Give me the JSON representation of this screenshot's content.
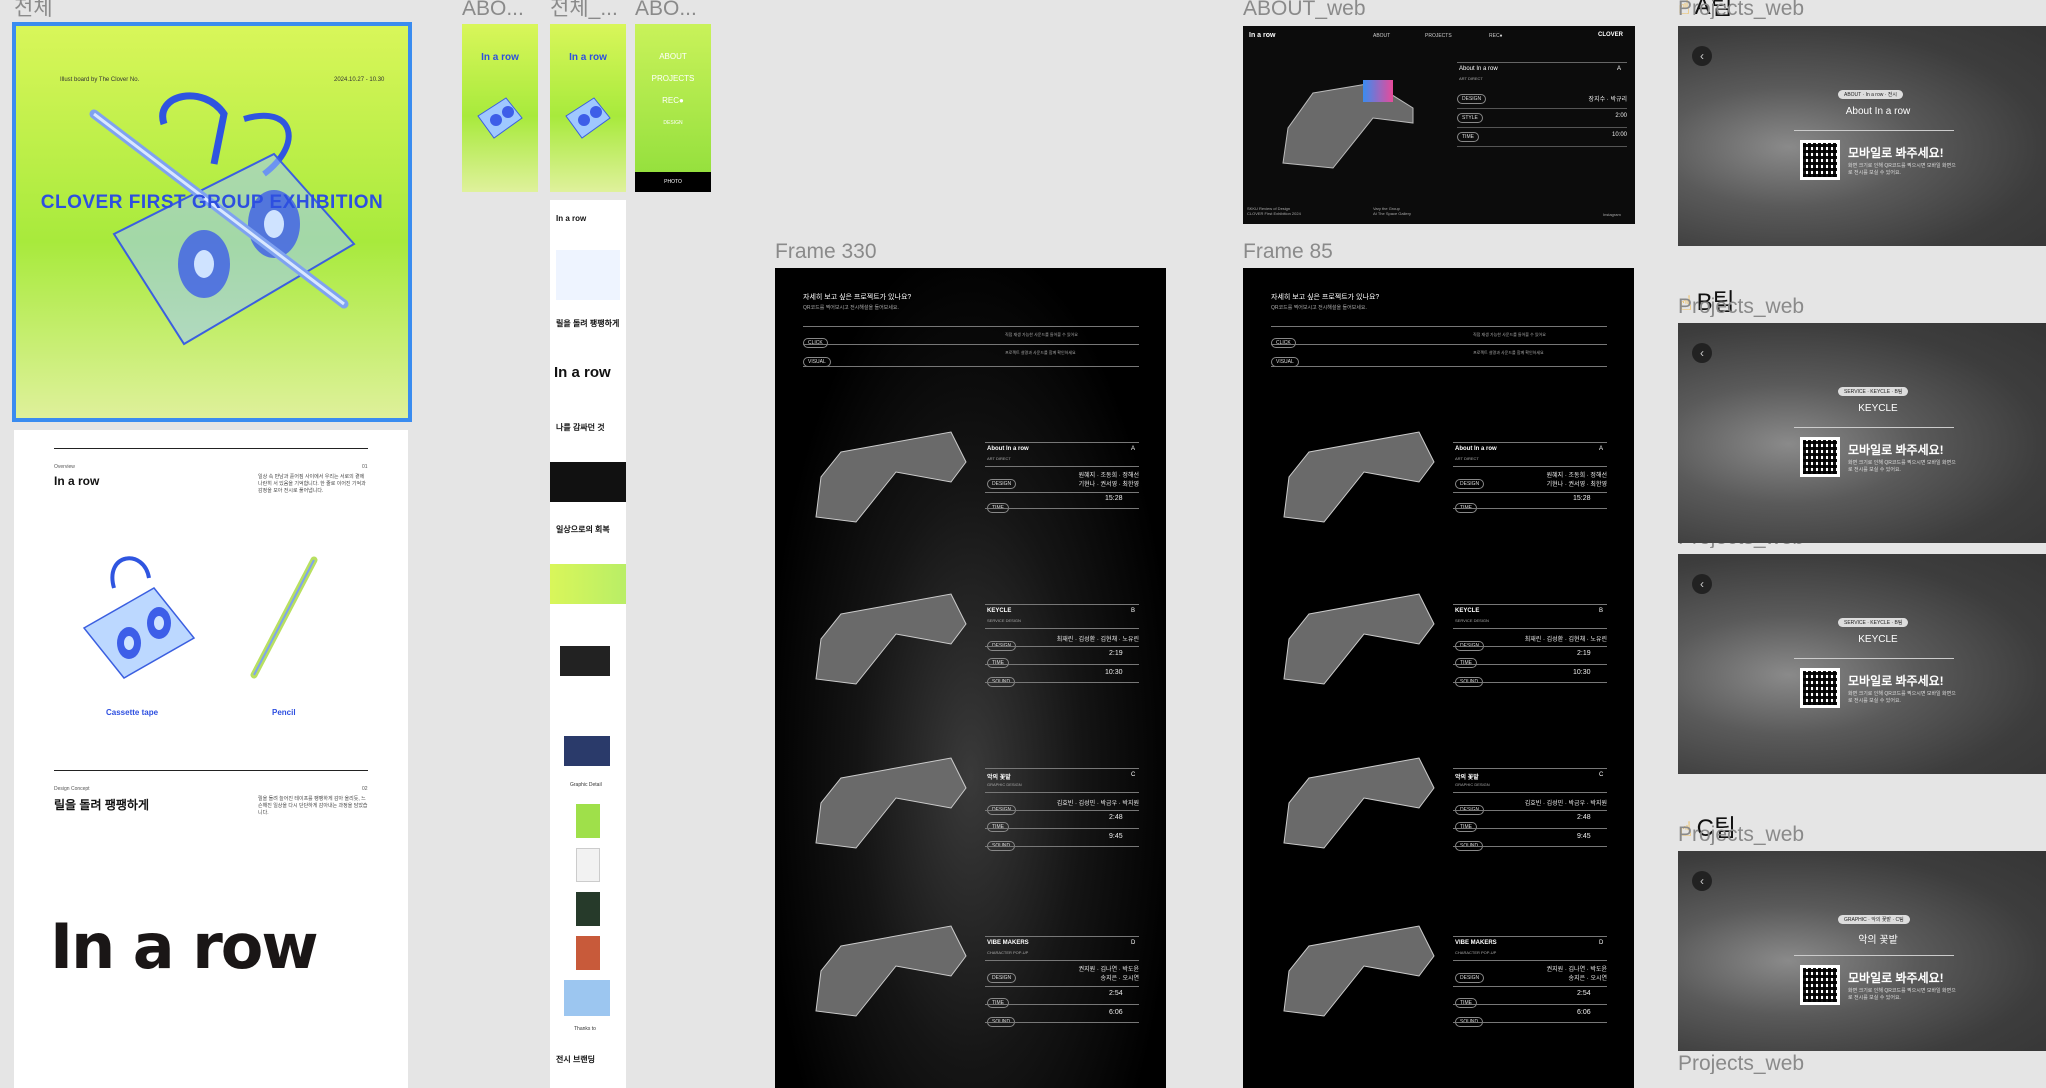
{
  "frames": {
    "f1": "전체",
    "f2": "ABO...",
    "f3": "전체_...",
    "f4": "ABO...",
    "about_web": "ABOUT_web",
    "frame330": "Frame 330",
    "frame85": "Frame 85",
    "projects_web": "Projects_web"
  },
  "teams": {
    "a": "A팀",
    "b": "B팀",
    "c": "C팀"
  },
  "poster": {
    "top_left": "Illust board by The Clover No.",
    "top_right": "2024.10.27 - 10.30",
    "headline": "CLOVER FIRST GROUP EXHIBITION"
  },
  "doc": {
    "section1_kicker": "Overview",
    "section1_num": "01",
    "section1_title": "In a row",
    "section1_body": "일상 속 만남과 흩어짐 사이에서 우리는 서로의 곁에 나란히 서 있음을 기억합니다. 한 줄로 이어진 기억과 감정을 모아 전시로 풀어냅니다.",
    "caption_tape": "Cassette tape",
    "caption_pencil": "Pencil",
    "section2_kicker": "Design Concept",
    "section2_num": "02",
    "section2_title": "릴을 돌려 팽팽하게",
    "section2_body": "릴을 돌려 늘어진 테이프를 팽팽하게 감아 올리듯, 느슨해진 일상을 다시 단단하게 감아내는 과정을 담았습니다.",
    "logo": "In a row"
  },
  "mobile_strip": {
    "logo": "In a row",
    "menu": [
      "ABOUT",
      "PROJECTS",
      "REC●",
      "DESIGN"
    ],
    "footer": "PHOTO",
    "sections": [
      "In a row",
      "릴을 돌려 팽팽하게",
      "나를 감싸던 것",
      "일상으로의 회복"
    ],
    "graphic_label": "Graphic Detail",
    "thanks": "Thanks to",
    "exhibition": "전시 브랜딩"
  },
  "about_web": {
    "nav_logo": "In a row",
    "nav": [
      "ABOUT",
      "PROJECTS",
      "REC●"
    ],
    "brand": "CLOVER",
    "title": "About In a row",
    "letter": "A",
    "sub": "ART DIRECT",
    "rows": [
      {
        "tag": "DESIGN",
        "value": "장지수 · 박규리"
      },
      {
        "tag": "STYLE",
        "value": "2:00"
      },
      {
        "tag": "TIME",
        "value": "10:00"
      }
    ],
    "footer_left": "SKKU Review of Design\nCLOVER First Exhibition 2024",
    "footer_mid": "Vary the Group\nAt The Space Gallery",
    "footer_right": "Instagram"
  },
  "frame_common": {
    "question": "자세히 보고 싶은 프로젝트가 있나요?",
    "question_sub": "QR코드를 찍어보시고 전시해설을 들어보세요.",
    "tag1": "CLICK",
    "note1": "직접 재생 가능한 사운드를 들어볼 수 있어요",
    "tag2": "VISUAL",
    "note2": "프로젝트 설명과 사운드를 함께 확인하세요"
  },
  "projects": [
    {
      "name": "About In a row",
      "letter": "A",
      "sub": "ART DIRECT",
      "people": "원혜지 · 조동희 · 정해선\n기현나 · 권서영 · 최한영",
      "time": "15:28"
    },
    {
      "name": "KEYCLE",
      "letter": "B",
      "sub": "SERVICE DESIGN",
      "people": "최재린 · 김성환 · 김현채 · 노유린",
      "time1": "2:19",
      "time2": "10:30"
    },
    {
      "name": "악의 꽃밭",
      "letter": "C",
      "sub": "GRAPHIC DESIGN",
      "people": "김효빈 · 김성민 · 박금우 · 박지원",
      "time1": "2:48",
      "time2": "9:45"
    },
    {
      "name": "VIBE MAKERS",
      "letter": "D",
      "sub": "CHARACTER POP-UP",
      "people": "권지원 · 김나연 · 박도윤\n송지은 · 오시연",
      "time1": "2:54",
      "time2": "6:06"
    }
  ],
  "row_tags": [
    "DESIGN",
    "TIME",
    "SOUND"
  ],
  "mobile_cards": [
    {
      "chip": "ABOUT · In a row · 전시",
      "title": "About In a row",
      "cta": "모바일로 봐주세요!",
      "desc": "화면 크기로 인해 QR코드를 찍으시면 모바일 화면으로 전시를 보실 수 있어요."
    },
    {
      "chip": "SERVICE · KEYCLE · B팀",
      "title": "KEYCLE",
      "cta": "모바일로 봐주세요!",
      "desc": "화면 크기로 인해 QR코드를 찍으시면 모바일 화면으로 전시를 보실 수 있어요."
    },
    {
      "chip": "SERVICE · KEYCLE · B팀",
      "title": "KEYCLE",
      "cta": "모바일로 봐주세요!",
      "desc": "화면 크기로 인해 QR코드를 찍으시면 모바일 화면으로 전시를 보실 수 있어요."
    },
    {
      "chip": "GRAPHIC · 악의 꽃밭 · C팀",
      "title": "악의 꽃밭",
      "cta": "모바일로 봐주세요!",
      "desc": "화면 크기로 인해 QR코드를 찍으시면 모바일 화면으로 전시를 보실 수 있어요."
    }
  ],
  "icons": {
    "back": "chevron-left-icon",
    "play": "play-icon",
    "hand": "pointing-hand-icon"
  }
}
